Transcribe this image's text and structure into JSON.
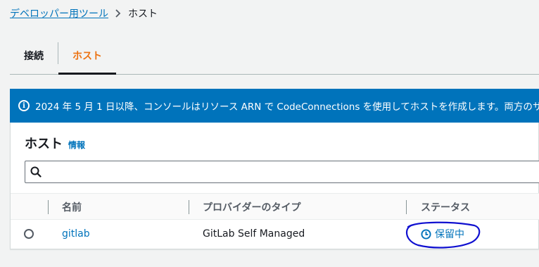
{
  "breadcrumb": {
    "parent": "デベロッパー用ツール",
    "current": "ホスト"
  },
  "tabs": [
    {
      "label": "接続",
      "active": false
    },
    {
      "label": "ホスト",
      "active": true
    }
  ],
  "banner": {
    "text": "2024 年 5 月 1 日以降、コンソールはリソース ARN で CodeConnections を使用してホストを作成します。両方のサ"
  },
  "panel": {
    "title": "ホスト",
    "info_link": "情報",
    "search": {
      "value": "",
      "placeholder": ""
    }
  },
  "table": {
    "columns": [
      "名前",
      "プロバイダーのタイプ",
      "ステータス"
    ],
    "rows": [
      {
        "name": "gitlab",
        "provider": "GitLab Self Managed",
        "status": "保留中"
      }
    ]
  },
  "colors": {
    "accent": "#0073bb",
    "active_tab": "#ec7211",
    "annotation": "#1010d0"
  }
}
